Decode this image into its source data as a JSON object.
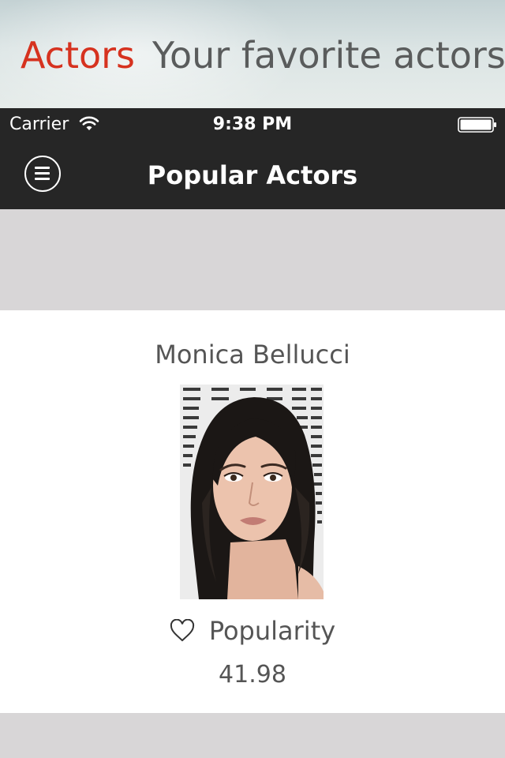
{
  "banner": {
    "accent": "Actors",
    "tagline": "Your favorite actors"
  },
  "status_bar": {
    "carrier": "Carrier",
    "time": "9:38 PM",
    "icons": [
      "wifi-icon",
      "battery-icon"
    ]
  },
  "nav": {
    "title": "Popular Actors",
    "menu_icon": "menu-icon"
  },
  "actor": {
    "name": "Monica Bellucci",
    "popularity_label": "Popularity",
    "popularity_value": "41.98",
    "popularity_icon": "heart-icon"
  },
  "colors": {
    "accent": "#d6321f",
    "bar_bg": "#262626",
    "page_bg": "#d8d6d7",
    "text": "#555555"
  }
}
